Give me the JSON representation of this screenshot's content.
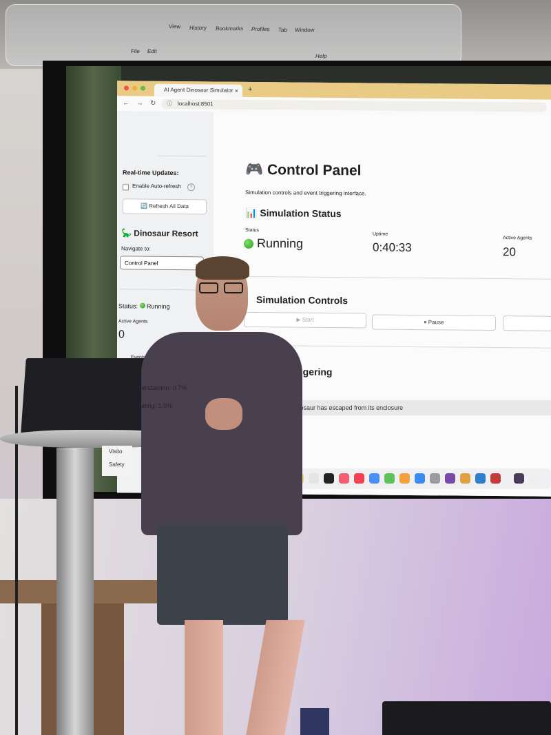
{
  "menubar": {
    "items_top": [
      "View",
      "History",
      "Bookmarks",
      "Profiles",
      "Tab",
      "Window"
    ],
    "items_bottom": [
      "File",
      "Edit",
      "Help"
    ]
  },
  "browser": {
    "tab_title": "AI Agent Dinosaur Simulator",
    "tab_close": "×",
    "new_tab": "+",
    "url": "localhost:8501",
    "nav": {
      "back": "←",
      "forward": "→",
      "reload": "↻",
      "info": "ⓘ"
    }
  },
  "sidebar": {
    "realtime_heading": "Real-time Updates:",
    "auto_refresh_label": "Enable Auto-refresh",
    "help_glyph": "?",
    "refresh_button": "🔄 Refresh All Data",
    "resort_title": "🦕 Dinosaur Resort",
    "navigate_label": "Navigate to:",
    "navigate_value": "Control Panel",
    "status_label": "Status:",
    "status_value": "Running",
    "active_agents_label": "Active Agents",
    "active_agents_value": "0",
    "events_label": "Events"
  },
  "main": {
    "title": "🎮 Control Panel",
    "subtitle": "Simulation controls and event triggering interface.",
    "status_heading": "📊 Simulation Status",
    "status_label": "Status",
    "status_value": "Running",
    "uptime_label": "Uptime",
    "uptime_value": "0:40:33",
    "agents_label": "Active Agents",
    "agents_value": "20",
    "controls_heading": "Simulation Controls",
    "start_button": "▶ Start",
    "pause_button": "⏸ Pause",
    "triggering_heading": "Triggering",
    "alert_text": "E - A dinosaur has escaped from its enclosure"
  },
  "podium_card": {
    "line1": "Visito",
    "line2": "Safety"
  },
  "shirt_overlay": {
    "satisfaction": "atisfaction: 0.7%",
    "rating": "ating: 1.0%"
  },
  "colors": {
    "tab_bar": "#eacb86",
    "status_green": "#2d9a22",
    "shirt": "#48404f",
    "wall_purple": "#c8a9de"
  }
}
